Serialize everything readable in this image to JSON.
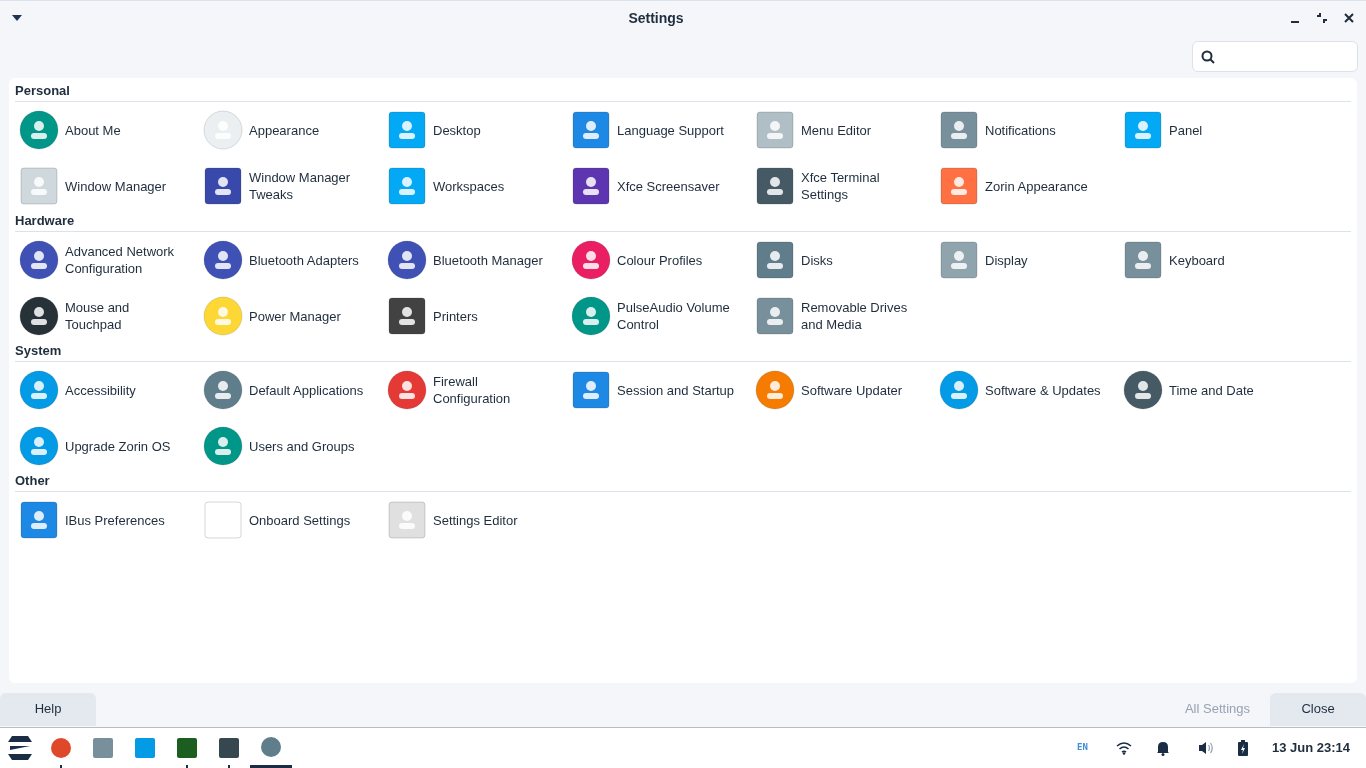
{
  "window": {
    "title": "Settings"
  },
  "sections": [
    {
      "title": "Personal",
      "items": [
        {
          "label": "About Me"
        },
        {
          "label": "Appearance"
        },
        {
          "label": "Desktop"
        },
        {
          "label": "Language Support"
        },
        {
          "label": "Menu Editor"
        },
        {
          "label": "Notifications"
        },
        {
          "label": "Panel"
        },
        {
          "label": "Window Manager"
        },
        {
          "label": "Window Manager Tweaks"
        },
        {
          "label": "Workspaces"
        },
        {
          "label": "Xfce Screensaver"
        },
        {
          "label": "Xfce Terminal Settings"
        },
        {
          "label": "Zorin Appearance"
        }
      ]
    },
    {
      "title": "Hardware",
      "items": [
        {
          "label": "Advanced Network Configuration"
        },
        {
          "label": "Bluetooth Adapters"
        },
        {
          "label": "Bluetooth Manager"
        },
        {
          "label": "Colour Profiles"
        },
        {
          "label": "Disks"
        },
        {
          "label": "Display"
        },
        {
          "label": "Keyboard"
        },
        {
          "label": "Mouse and Touchpad"
        },
        {
          "label": "Power Manager"
        },
        {
          "label": "Printers"
        },
        {
          "label": "PulseAudio Volume Control"
        },
        {
          "label": "Removable Drives and Media"
        }
      ]
    },
    {
      "title": "System",
      "items": [
        {
          "label": "Accessibility"
        },
        {
          "label": "Default Applications"
        },
        {
          "label": "Firewall Configuration"
        },
        {
          "label": "Session and Startup"
        },
        {
          "label": "Software Updater"
        },
        {
          "label": "Software & Updates"
        },
        {
          "label": "Time and Date"
        },
        {
          "label": "Upgrade Zorin OS"
        },
        {
          "label": "Users and Groups"
        }
      ]
    },
    {
      "title": "Other",
      "items": [
        {
          "label": "IBus Preferences"
        },
        {
          "label": "Onboard Settings"
        },
        {
          "label": "Settings Editor"
        }
      ]
    }
  ],
  "buttons": {
    "help": "Help",
    "all_settings": {
      "label": "All Settings",
      "disabled": true
    },
    "close": "Close"
  },
  "taskbar": {
    "apps": [
      {
        "running": true,
        "active": false
      },
      {
        "running": false,
        "active": false
      },
      {
        "running": false,
        "active": false
      },
      {
        "running": true,
        "active": false
      },
      {
        "running": true,
        "active": false
      },
      {
        "running": false,
        "active": true
      }
    ],
    "language": "EN",
    "clock": "13 Jun 23:14"
  }
}
